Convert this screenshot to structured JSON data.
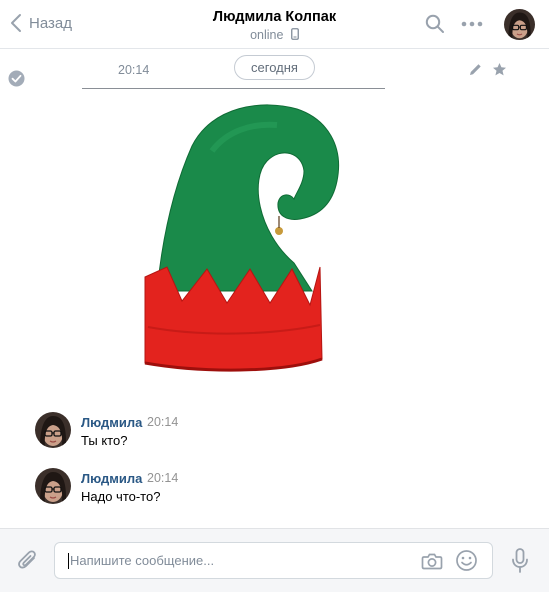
{
  "header": {
    "back_label": "Назад",
    "title": "Людмила Колпак",
    "status": "online"
  },
  "feed": {
    "first_message_time": "20:14",
    "date_divider": "сегодня",
    "messages": [
      {
        "author": "Людмила",
        "time": "20:14",
        "text": "Ты кто?"
      },
      {
        "author": "Людмила",
        "time": "20:14",
        "text": "Надо что-то?"
      }
    ]
  },
  "composer": {
    "placeholder": "Напишите сообщение..."
  },
  "icons": [
    "chevron-left-icon",
    "phone-icon",
    "search-icon",
    "more-icon",
    "check-circle-icon",
    "pencil-icon",
    "star-icon",
    "paperclip-icon",
    "camera-icon",
    "smile-icon",
    "microphone-icon"
  ],
  "colors": {
    "accent": "#2a5885",
    "muted": "#818c99",
    "hat_green": "#17874a",
    "hat_red": "#e3231e"
  }
}
